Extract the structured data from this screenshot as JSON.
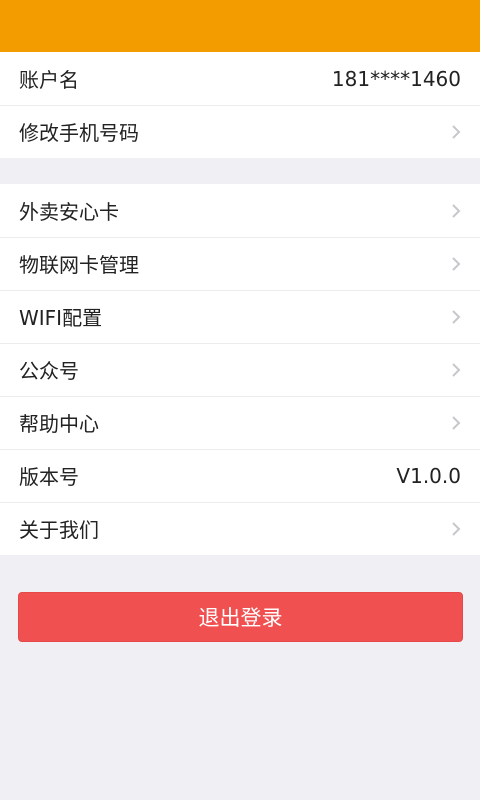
{
  "colors": {
    "header": "#f39c00",
    "logout": "#f05050",
    "background": "#efeff4",
    "chevron": "#c7c7cc"
  },
  "account": {
    "name_label": "账户名",
    "name_value": "181****1460",
    "phone_label": "修改手机号码"
  },
  "menu": {
    "items": [
      {
        "label": "外卖安心卡",
        "icon": "chevron-right-icon"
      },
      {
        "label": "物联网卡管理",
        "icon": "chevron-right-icon"
      },
      {
        "label": "WIFI配置",
        "icon": "chevron-right-icon"
      },
      {
        "label": "公众号",
        "icon": "chevron-right-icon"
      },
      {
        "label": "帮助中心",
        "icon": "chevron-right-icon"
      }
    ],
    "version_label": "版本号",
    "version_value": "V1.0.0",
    "about_label": "关于我们"
  },
  "logout": {
    "label": "退出登录"
  }
}
